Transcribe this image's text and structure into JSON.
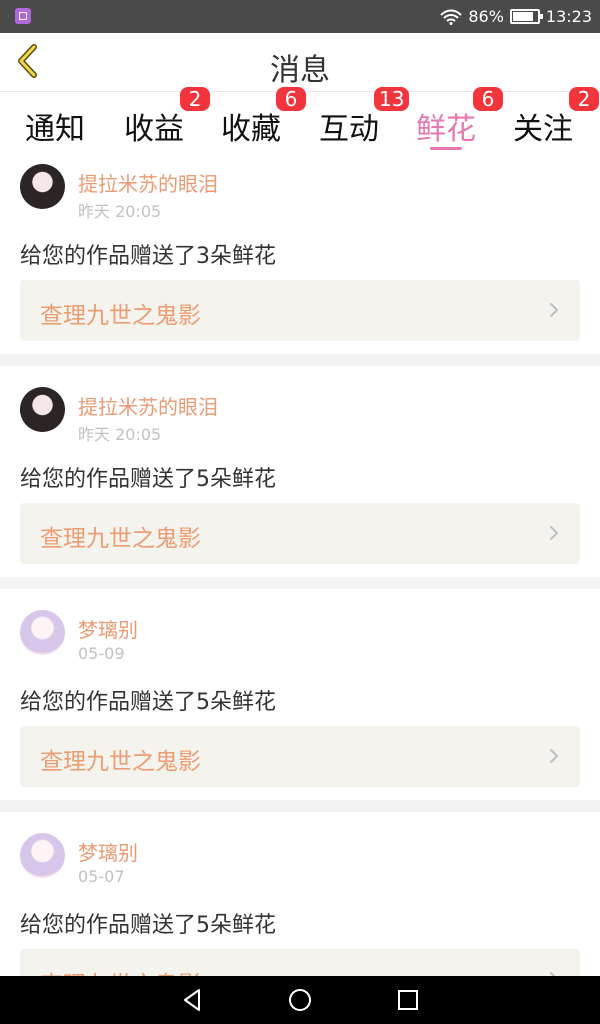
{
  "status_bar": {
    "battery": "86%",
    "time": "13:23"
  },
  "header": {
    "title": "消息"
  },
  "tabs": [
    {
      "label": "通知",
      "badge": null
    },
    {
      "label": "收益",
      "badge": "2"
    },
    {
      "label": "收藏",
      "badge": "6"
    },
    {
      "label": "互动",
      "badge": "13"
    },
    {
      "label": "鲜花",
      "badge": "6",
      "active": true
    },
    {
      "label": "关注",
      "badge": "2"
    }
  ],
  "messages": [
    {
      "sender": "提拉米苏的眼泪",
      "time": "昨天 20:05",
      "text": "给您的作品赠送了3朵鲜花",
      "work_title": "查理九世之鬼影",
      "avatar": "dark-portrait"
    },
    {
      "sender": "提拉米苏的眼泪",
      "time": "昨天 20:05",
      "text": "给您的作品赠送了5朵鲜花",
      "work_title": "查理九世之鬼影",
      "avatar": "dark-portrait"
    },
    {
      "sender": "梦璃别",
      "time": "05-09",
      "text": "给您的作品赠送了5朵鲜花",
      "work_title": "查理九世之鬼影",
      "avatar": "pastel-portrait"
    },
    {
      "sender": "梦璃别",
      "time": "05-07",
      "text": "给您的作品赠送了5朵鲜花",
      "work_title": "查理九世之鬼影",
      "avatar": "pastel-portrait"
    }
  ],
  "colors": {
    "accent": "#e777b1",
    "name": "#ea9b74",
    "badge": "#f2343d",
    "status_bar": "#4a4a4a"
  }
}
